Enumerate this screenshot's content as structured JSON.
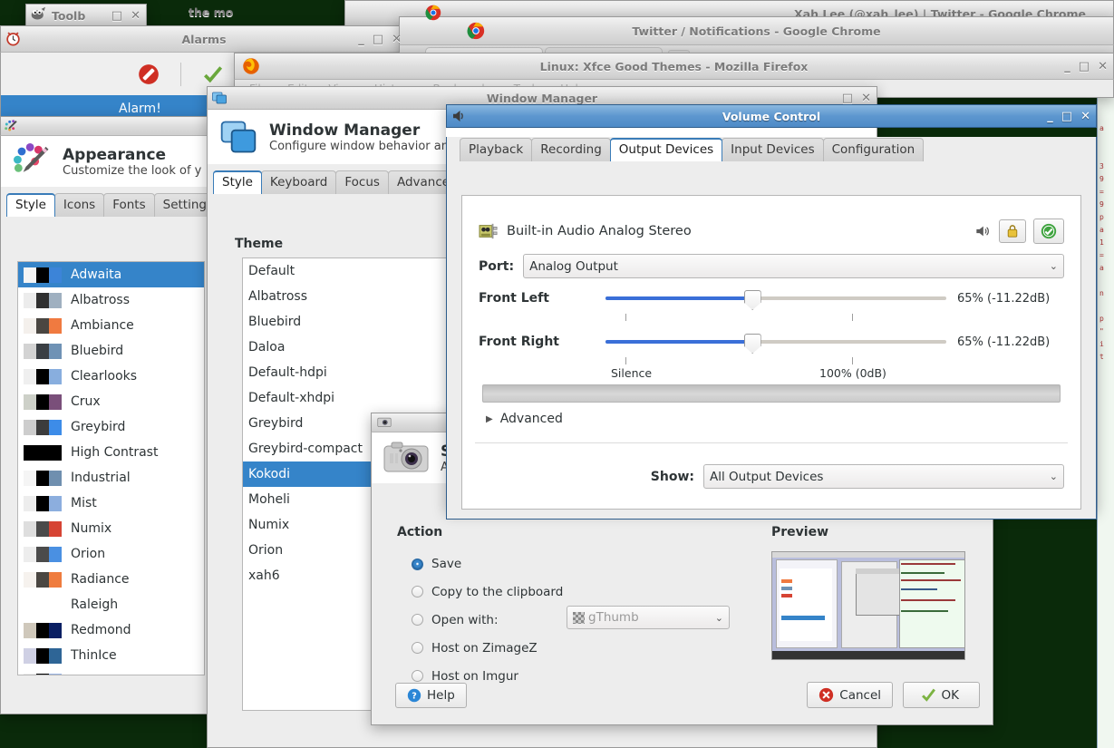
{
  "desktop": {
    "background_color": "#0a2a0a"
  },
  "windows": {
    "gimp_toolbox": {
      "title": "Toolb",
      "icon": "gimp-wilber-icon"
    },
    "alarms": {
      "title": "Alarms",
      "banner_text": "Alarm!",
      "icon": "alarm-clock-icon"
    },
    "chrome_back": {
      "title": "Xah Lee (@xah_lee) | Twitter - Google Chrome"
    },
    "chrome_front": {
      "title": "Twitter / Notifications - Google Chrome",
      "partial_text": "the mo"
    },
    "firefox": {
      "title": "Linux: Xfce Good Themes - Mozilla Firefox",
      "menu": [
        "File",
        "Edit",
        "View",
        "History",
        "Bookmarks",
        "Tools",
        "Help"
      ]
    },
    "appearance": {
      "title": "Appearance",
      "subtitle": "Customize the look of y",
      "tabs": [
        "Style",
        "Icons",
        "Fonts",
        "Settings"
      ],
      "selected_tab": "Style",
      "themes": [
        {
          "name": "Adwaita",
          "selected": true,
          "swatch": [
            "#f4f4f4",
            "#000000",
            "#3c84d8"
          ]
        },
        {
          "name": "Albatross",
          "selected": false,
          "swatch": [
            "#ececec",
            "#303030",
            "#9fb0c0"
          ]
        },
        {
          "name": "Ambiance",
          "selected": false,
          "swatch": [
            "#f4f0ec",
            "#4a4641",
            "#f07a40"
          ]
        },
        {
          "name": "Bluebird",
          "selected": false,
          "swatch": [
            "#d3d3d3",
            "#3a3f44",
            "#6f92b5"
          ]
        },
        {
          "name": "Clearlooks",
          "selected": false,
          "swatch": [
            "#efefef",
            "#000000",
            "#88aede"
          ]
        },
        {
          "name": "Crux",
          "selected": false,
          "swatch": [
            "#cdd0c8",
            "#000000",
            "#7a4f7a"
          ]
        },
        {
          "name": "Greybird",
          "selected": false,
          "swatch": [
            "#cdcdcd",
            "#3c3c3c",
            "#3d8ce8"
          ]
        },
        {
          "name": "High Contrast",
          "selected": false,
          "swatch": [
            "#000000",
            "#000000",
            "#000000"
          ]
        },
        {
          "name": "Industrial",
          "selected": false,
          "swatch": [
            "#f5f5f5",
            "#000000",
            "#6f8faf"
          ]
        },
        {
          "name": "Mist",
          "selected": false,
          "swatch": [
            "#ededed",
            "#000000",
            "#8caede"
          ]
        },
        {
          "name": "Numix",
          "selected": false,
          "swatch": [
            "#dedede",
            "#4a4a4a",
            "#d64434"
          ]
        },
        {
          "name": "Orion",
          "selected": false,
          "swatch": [
            "#ededed",
            "#4b4b4b",
            "#4a90e2"
          ]
        },
        {
          "name": "Radiance",
          "selected": false,
          "swatch": [
            "#f6f2ee",
            "#4a4641",
            "#ef7c3e"
          ]
        },
        {
          "name": "Raleigh",
          "selected": false,
          "swatch": []
        },
        {
          "name": "Redmond",
          "selected": false,
          "swatch": [
            "#cfc8bb",
            "#000000",
            "#0a1f63"
          ]
        },
        {
          "name": "ThinIce",
          "selected": false,
          "swatch": [
            "#cfd0e4",
            "#000000",
            "#2e6596"
          ]
        },
        {
          "name": "xah6",
          "selected": false,
          "swatch": [
            "#ececec",
            "#000000",
            "#9ab5e5"
          ]
        }
      ]
    },
    "window_manager": {
      "title": "Window Manager",
      "header_title": "Window Manager",
      "subtitle": "Configure window behavior an",
      "tabs": [
        "Style",
        "Keyboard",
        "Focus",
        "Advanced"
      ],
      "selected_tab": "Style",
      "section_label": "Theme",
      "themes": [
        {
          "name": "Default",
          "selected": false
        },
        {
          "name": "Albatross",
          "selected": false
        },
        {
          "name": "Bluebird",
          "selected": false
        },
        {
          "name": "Daloa",
          "selected": false
        },
        {
          "name": "Default-hdpi",
          "selected": false
        },
        {
          "name": "Default-xhdpi",
          "selected": false
        },
        {
          "name": "Greybird",
          "selected": false
        },
        {
          "name": "Greybird-compact",
          "selected": false
        },
        {
          "name": "Kokodi",
          "selected": true
        },
        {
          "name": "Moheli",
          "selected": false
        },
        {
          "name": "Numix",
          "selected": false
        },
        {
          "name": "Orion",
          "selected": false
        },
        {
          "name": "xah6",
          "selected": false
        }
      ]
    },
    "screenshot": {
      "title": "S",
      "subtitle": "A",
      "action_label": "Action",
      "options": [
        {
          "label": "Save",
          "selected": true
        },
        {
          "label": "Copy to the clipboard",
          "selected": false
        },
        {
          "label": "Open with:",
          "selected": false
        },
        {
          "label": "Host on ZimageZ",
          "selected": false
        },
        {
          "label": "Host on Imgur",
          "selected": false
        }
      ],
      "open_with_value": "gThumb",
      "preview_label": "Preview",
      "help_label": "Help",
      "cancel_label": "Cancel",
      "ok_label": "OK"
    },
    "volume_control": {
      "title": "Volume Control",
      "tabs": [
        "Playback",
        "Recording",
        "Output Devices",
        "Input Devices",
        "Configuration"
      ],
      "selected_tab": "Output Devices",
      "device_name": "Built-in Audio Analog Stereo",
      "port_label": "Port:",
      "port_value": "Analog Output",
      "channels": [
        {
          "label": "Front Left",
          "value": "65% (-11.22dB)",
          "percent": 65
        },
        {
          "label": "Front Right",
          "value": "65% (-11.22dB)",
          "percent": 65
        }
      ],
      "scale_min_label": "Silence",
      "scale_max_label": "100% (0dB)",
      "advanced_label": "Advanced",
      "show_label": "Show:",
      "show_value": "All Output Devices",
      "icons": [
        "speaker-icon",
        "lock-icon",
        "default-device-check-icon"
      ],
      "accent_color": "#3a6fd8",
      "titlebar_color": "#5d97cf"
    }
  }
}
